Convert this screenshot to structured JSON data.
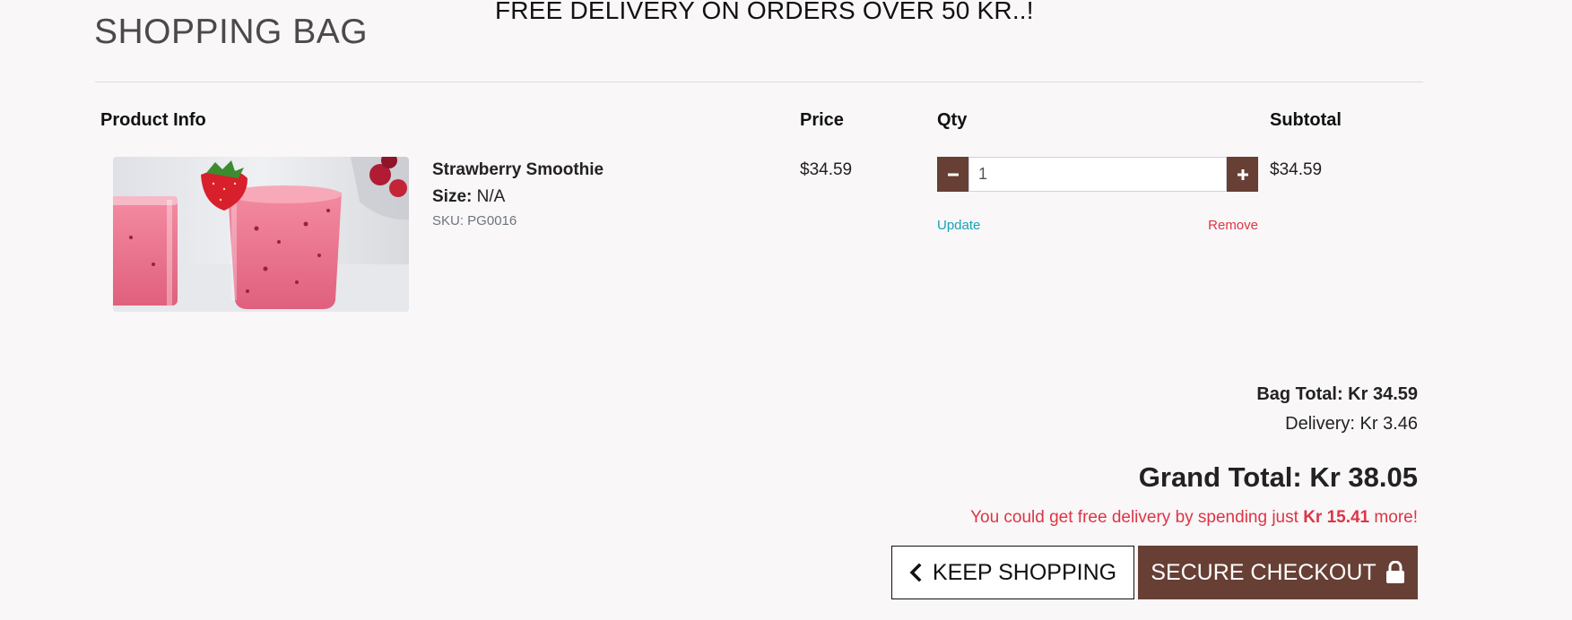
{
  "banner": {
    "text": "FREE DELIVERY ON ORDERS OVER 50 KR..!"
  },
  "page": {
    "title": "SHOPPING BAG"
  },
  "table": {
    "headers": {
      "product_info": "Product Info",
      "price": "Price",
      "qty": "Qty",
      "subtotal": "Subtotal"
    },
    "items": [
      {
        "name": "Strawberry Smoothie",
        "size_label": "Size:",
        "size_value": "N/A",
        "sku": "SKU: PG0016",
        "price": "$34.59",
        "quantity": "1",
        "subtotal": "$34.59",
        "update_label": "Update",
        "remove_label": "Remove",
        "image_icon": "strawberry-smoothie-photo"
      }
    ]
  },
  "summary": {
    "bag_total": "Bag Total: Kr 34.59",
    "delivery": "Delivery: Kr 3.46",
    "grand_total": "Grand Total: Kr 38.05",
    "free_delivery_prefix": "You could get free delivery by spending just",
    "free_delivery_amount": "Kr 15.41",
    "free_delivery_suffix": "more!"
  },
  "actions": {
    "keep_shopping_label": "KEEP SHOPPING",
    "keep_shopping_icon": "chevron-left-icon",
    "checkout_label": "SECURE CHECKOUT",
    "checkout_icon": "lock-icon"
  },
  "colors": {
    "background": "#f9f7f8",
    "brand": "#673f35",
    "update_link": "#17a2b8",
    "danger": "#dc3545"
  }
}
